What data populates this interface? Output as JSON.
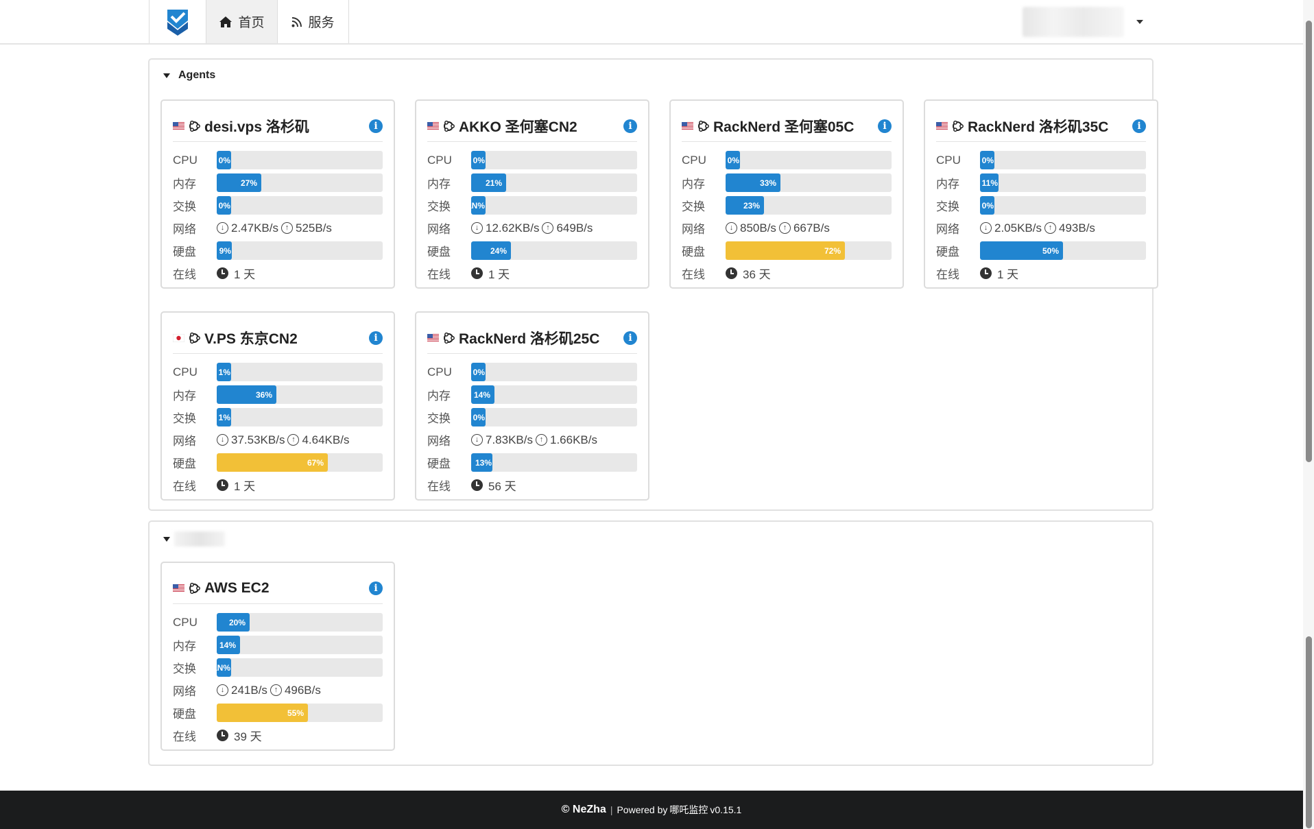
{
  "nav": {
    "home": "首页",
    "services": "服务"
  },
  "groups": [
    {
      "title": "Agents",
      "cards": [
        {
          "flag": "us",
          "name": "desi.vps 洛杉矶",
          "cpu": "0%",
          "cpu_pct": 0,
          "mem": "27%",
          "mem_pct": 27,
          "swap": "0%",
          "swap_pct": 0,
          "net_down": "2.47KB/s",
          "net_up": "525B/s",
          "disk": "9%",
          "disk_pct": 9,
          "uptime": "1 天"
        },
        {
          "flag": "us",
          "name": "AKKO 圣何塞CN2",
          "cpu": "0%",
          "cpu_pct": 0,
          "mem": "21%",
          "mem_pct": 21,
          "swap": "NaN%",
          "swap_pct": 0,
          "net_down": "12.62KB/s",
          "net_up": "649B/s",
          "disk": "24%",
          "disk_pct": 24,
          "uptime": "1 天"
        },
        {
          "flag": "us",
          "name": "RackNerd 圣何塞05C",
          "cpu": "0%",
          "cpu_pct": 0,
          "mem": "33%",
          "mem_pct": 33,
          "swap": "23%",
          "swap_pct": 23,
          "net_down": "850B/s",
          "net_up": "667B/s",
          "disk": "72%",
          "disk_pct": 72,
          "uptime": "36 天"
        },
        {
          "flag": "us",
          "name": "RackNerd 洛杉矶35C",
          "cpu": "0%",
          "cpu_pct": 0,
          "mem": "11%",
          "mem_pct": 11,
          "swap": "0%",
          "swap_pct": 0,
          "net_down": "2.05KB/s",
          "net_up": "493B/s",
          "disk": "50%",
          "disk_pct": 50,
          "uptime": "1 天"
        },
        {
          "flag": "jp",
          "name": "V.PS 东京CN2",
          "cpu": "1%",
          "cpu_pct": 1,
          "mem": "36%",
          "mem_pct": 36,
          "swap": "1%",
          "swap_pct": 1,
          "net_down": "37.53KB/s",
          "net_up": "4.64KB/s",
          "disk": "67%",
          "disk_pct": 67,
          "uptime": "1 天"
        },
        {
          "flag": "us",
          "name": "RackNerd 洛杉矶25C",
          "cpu": "0%",
          "cpu_pct": 0,
          "mem": "14%",
          "mem_pct": 14,
          "swap": "0%",
          "swap_pct": 0,
          "net_down": "7.83KB/s",
          "net_up": "1.66KB/s",
          "disk": "13%",
          "disk_pct": 13,
          "uptime": "56 天"
        }
      ]
    },
    {
      "title": "",
      "cards": [
        {
          "flag": "us",
          "name": "AWS EC2",
          "cpu": "20%",
          "cpu_pct": 20,
          "mem": "14%",
          "mem_pct": 14,
          "swap": "NaN%",
          "swap_pct": 0,
          "net_down": "241B/s",
          "net_up": "496B/s",
          "disk": "55%",
          "disk_pct": 55,
          "uptime": "39 天"
        }
      ]
    }
  ],
  "labels": {
    "cpu": "CPU",
    "mem": "内存",
    "swap": "交换",
    "net": "网络",
    "disk": "硬盘",
    "uptime": "在线"
  },
  "footer": {
    "brand": "© NeZha",
    "sep": "|",
    "powered": "Powered by",
    "product": "哪吒监控",
    "version": "v0.15.1"
  },
  "colors": {
    "accent": "#2185d0",
    "warn": "#f2c037",
    "footer_bg": "#1b1c1d"
  },
  "icons": {
    "brand": "nezha-logo-icon",
    "home": "home-icon",
    "services": "rss-icon",
    "os": "ubuntu-icon",
    "info": "info-icon",
    "download": "download-arrow-icon",
    "upload": "upload-arrow-icon",
    "clock": "clock-icon"
  }
}
